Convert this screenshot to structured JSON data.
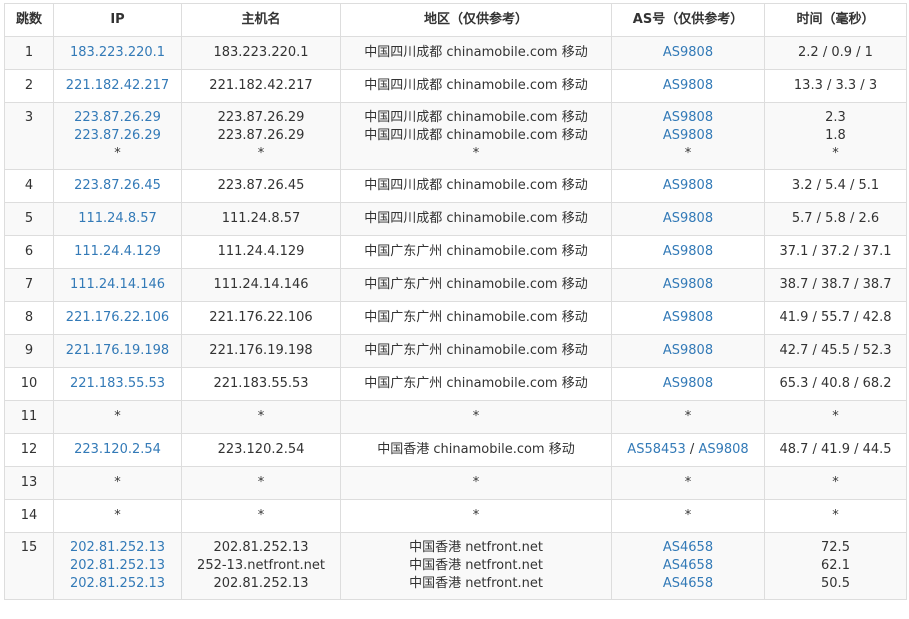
{
  "columns": {
    "hop": "跳数",
    "ip": "IP",
    "hostname": "主机名",
    "region": "地区（仅供参考）",
    "asn": "AS号（仅供参考）",
    "time": "时间（毫秒）"
  },
  "rows": [
    {
      "hop": "1",
      "ip": [
        "183.223.220.1"
      ],
      "hostname": [
        "183.223.220.1"
      ],
      "region": [
        "中国四川成都 chinamobile.com 移动"
      ],
      "asn": [
        [
          "AS9808"
        ]
      ],
      "time": [
        "2.2 / 0.9 / 1"
      ]
    },
    {
      "hop": "2",
      "ip": [
        "221.182.42.217"
      ],
      "hostname": [
        "221.182.42.217"
      ],
      "region": [
        "中国四川成都 chinamobile.com 移动"
      ],
      "asn": [
        [
          "AS9808"
        ]
      ],
      "time": [
        "13.3 / 3.3 / 3"
      ]
    },
    {
      "hop": "3",
      "ip": [
        "223.87.26.29",
        "223.87.26.29",
        "*"
      ],
      "hostname": [
        "223.87.26.29",
        "223.87.26.29",
        "*"
      ],
      "region": [
        "中国四川成都 chinamobile.com 移动",
        "中国四川成都 chinamobile.com 移动",
        "*"
      ],
      "asn": [
        [
          "AS9808"
        ],
        [
          "AS9808"
        ],
        [
          "*"
        ]
      ],
      "time": [
        "2.3",
        "1.8",
        "*"
      ]
    },
    {
      "hop": "4",
      "ip": [
        "223.87.26.45"
      ],
      "hostname": [
        "223.87.26.45"
      ],
      "region": [
        "中国四川成都 chinamobile.com 移动"
      ],
      "asn": [
        [
          "AS9808"
        ]
      ],
      "time": [
        "3.2 / 5.4 / 5.1"
      ]
    },
    {
      "hop": "5",
      "ip": [
        "111.24.8.57"
      ],
      "hostname": [
        "111.24.8.57"
      ],
      "region": [
        "中国四川成都 chinamobile.com 移动"
      ],
      "asn": [
        [
          "AS9808"
        ]
      ],
      "time": [
        "5.7 / 5.8 / 2.6"
      ]
    },
    {
      "hop": "6",
      "ip": [
        "111.24.4.129"
      ],
      "hostname": [
        "111.24.4.129"
      ],
      "region": [
        "中国广东广州 chinamobile.com 移动"
      ],
      "asn": [
        [
          "AS9808"
        ]
      ],
      "time": [
        "37.1 / 37.2 / 37.1"
      ]
    },
    {
      "hop": "7",
      "ip": [
        "111.24.14.146"
      ],
      "hostname": [
        "111.24.14.146"
      ],
      "region": [
        "中国广东广州 chinamobile.com 移动"
      ],
      "asn": [
        [
          "AS9808"
        ]
      ],
      "time": [
        "38.7 / 38.7 / 38.7"
      ]
    },
    {
      "hop": "8",
      "ip": [
        "221.176.22.106"
      ],
      "hostname": [
        "221.176.22.106"
      ],
      "region": [
        "中国广东广州 chinamobile.com 移动"
      ],
      "asn": [
        [
          "AS9808"
        ]
      ],
      "time": [
        "41.9 / 55.7 / 42.8"
      ]
    },
    {
      "hop": "9",
      "ip": [
        "221.176.19.198"
      ],
      "hostname": [
        "221.176.19.198"
      ],
      "region": [
        "中国广东广州 chinamobile.com 移动"
      ],
      "asn": [
        [
          "AS9808"
        ]
      ],
      "time": [
        "42.7 / 45.5 / 52.3"
      ]
    },
    {
      "hop": "10",
      "ip": [
        "221.183.55.53"
      ],
      "hostname": [
        "221.183.55.53"
      ],
      "region": [
        "中国广东广州 chinamobile.com 移动"
      ],
      "asn": [
        [
          "AS9808"
        ]
      ],
      "time": [
        "65.3 / 40.8 / 68.2"
      ]
    },
    {
      "hop": "11",
      "ip": [
        "*"
      ],
      "hostname": [
        "*"
      ],
      "region": [
        "*"
      ],
      "asn": [
        [
          "*"
        ]
      ],
      "time": [
        "*"
      ]
    },
    {
      "hop": "12",
      "ip": [
        "223.120.2.54"
      ],
      "hostname": [
        "223.120.2.54"
      ],
      "region": [
        "中国香港 chinamobile.com 移动"
      ],
      "asn": [
        [
          "AS58453",
          "AS9808"
        ]
      ],
      "time": [
        "48.7 / 41.9 / 44.5"
      ]
    },
    {
      "hop": "13",
      "ip": [
        "*"
      ],
      "hostname": [
        "*"
      ],
      "region": [
        "*"
      ],
      "asn": [
        [
          "*"
        ]
      ],
      "time": [
        "*"
      ]
    },
    {
      "hop": "14",
      "ip": [
        "*"
      ],
      "hostname": [
        "*"
      ],
      "region": [
        "*"
      ],
      "asn": [
        [
          "*"
        ]
      ],
      "time": [
        "*"
      ]
    },
    {
      "hop": "15",
      "ip": [
        "202.81.252.13",
        "202.81.252.13",
        "202.81.252.13"
      ],
      "hostname": [
        "202.81.252.13",
        "252-13.netfront.net",
        "202.81.252.13"
      ],
      "region": [
        "中国香港 netfront.net",
        "中国香港 netfront.net",
        "中国香港 netfront.net"
      ],
      "asn": [
        [
          "AS4658"
        ],
        [
          "AS4658"
        ],
        [
          "AS4658"
        ]
      ],
      "time": [
        "72.5",
        "62.1",
        "50.5"
      ]
    }
  ],
  "asn_separator": " / ",
  "colors": {
    "link": "#337ab7",
    "text": "#333333",
    "border": "#dddddd",
    "stripe": "#f9f9f9"
  }
}
